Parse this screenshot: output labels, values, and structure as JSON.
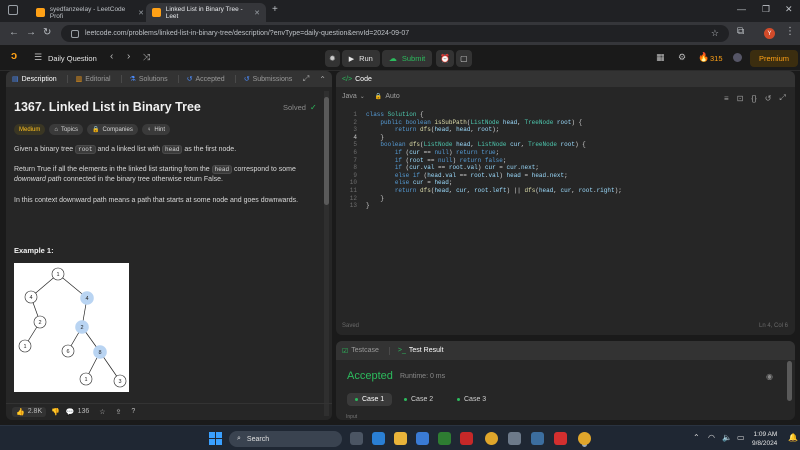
{
  "browser": {
    "tabs": [
      {
        "label": "syedfanzeelay - LeetCode Profi",
        "active": false
      },
      {
        "label": "Linked List in Binary Tree - Leet",
        "active": true
      }
    ],
    "new_tab": "+",
    "url": "leetcode.com/problems/linked-list-in-binary-tree/description/?envType=daily-question&envId=2024-09-07"
  },
  "topbar": {
    "daily_label": "Daily Question",
    "run_label": "Run",
    "submit_label": "Submit",
    "streak": "315",
    "premium_label": "Premium"
  },
  "desc_panel": {
    "tabs": [
      "Description",
      "Editorial",
      "Solutions",
      "Accepted",
      "Submissions"
    ],
    "title": "1367. Linked List in Binary Tree",
    "solved": "Solved",
    "chips": {
      "difficulty": "Medium",
      "topics": "Topics",
      "companies": "Companies",
      "hint": "Hint"
    },
    "p1_a": "Given a binary tree ",
    "p1_code1": "root",
    "p1_b": " and a linked list with ",
    "p1_code2": "head",
    "p1_c": " as the first node.",
    "p2_a": "Return True if all the elements in the linked list starting from the ",
    "p2_code": "head",
    "p2_b": " correspond to some ",
    "p2_em": "downward path",
    "p2_c": " connected in the binary tree otherwise return False.",
    "p3": "In this context downward path means a path that starts at some node and goes downwards.",
    "example": "Example 1:",
    "tree_nodes": [
      "1",
      "4",
      "4",
      "2",
      "2",
      "1",
      "6",
      "8",
      "1",
      "3"
    ],
    "likes": "2.8K",
    "comments": "136"
  },
  "code_panel": {
    "title": "Code",
    "language": "Java",
    "auto": "Auto",
    "status_left": "Saved",
    "status_right": "Ln 4, Col 6",
    "lines": [
      "class Solution {",
      "    public boolean isSubPath(ListNode head, TreeNode root) {",
      "        return dfs(head, head, root);",
      "    }",
      "    boolean dfs(ListNode head, ListNode cur, TreeNode root) {",
      "        if (cur == null) return true;",
      "        if (root == null) return false;",
      "        if (cur.val == root.val) cur = cur.next;",
      "        else if (head.val == root.val) head = head.next;",
      "        else cur = head;",
      "        return dfs(head, cur, root.left) || dfs(head, cur, root.right);",
      "    }",
      "}"
    ]
  },
  "result_panel": {
    "tabs": [
      "Testcase",
      "Test Result"
    ],
    "status": "Accepted",
    "runtime": "Runtime: 0 ms",
    "cases": [
      "Case 1",
      "Case 2",
      "Case 3"
    ],
    "input_label": "Input"
  },
  "taskbar": {
    "search": "Search",
    "time": "1:09 AM",
    "date": "9/8/2024"
  }
}
